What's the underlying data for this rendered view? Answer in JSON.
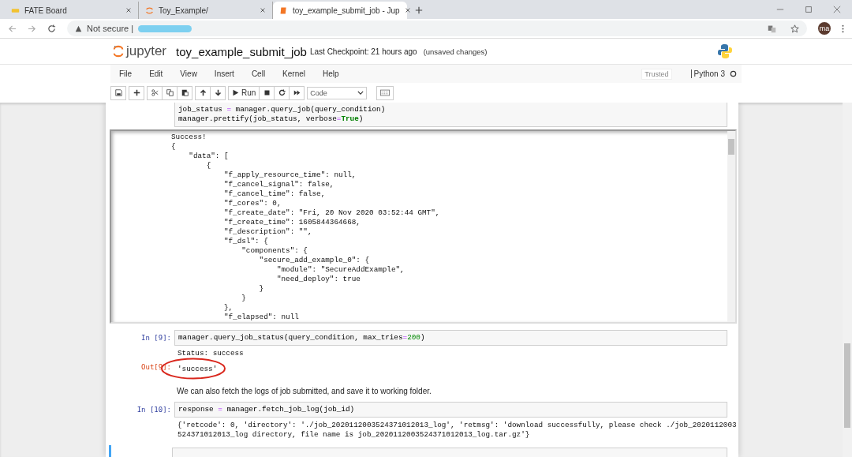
{
  "browser": {
    "tabs": [
      {
        "title": "FATE Board",
        "kind": "fate",
        "selected": false
      },
      {
        "title": "Toy_Example/",
        "kind": "jupyter",
        "selected": false
      },
      {
        "title": "toy_example_submit_job - Jup",
        "kind": "notebook",
        "selected": true
      }
    ],
    "security": "Not secure |",
    "avatar": "ma"
  },
  "header": {
    "logo": "jupyter",
    "title": "toy_example_submit_job",
    "checkpoint": "Last Checkpoint: 21 hours ago",
    "unsaved": "(unsaved changes)"
  },
  "menu": [
    "File",
    "Edit",
    "View",
    "Insert",
    "Cell",
    "Kernel",
    "Help"
  ],
  "trusted": "Trusted",
  "kernel": "Python 3",
  "toolbar": [
    [
      {
        "kind": "save"
      }
    ],
    [
      {
        "kind": "plus"
      }
    ],
    [
      {
        "kind": "cut"
      },
      {
        "kind": "copy"
      },
      {
        "kind": "paste"
      }
    ],
    [
      {
        "kind": "up"
      },
      {
        "kind": "down"
      }
    ],
    [
      {
        "kind": "run",
        "label": "Run"
      },
      {
        "kind": "stop"
      },
      {
        "kind": "restart"
      },
      {
        "kind": "fastforward"
      }
    ]
  ],
  "cell_type": "Code",
  "cells": [
    {
      "kind": "code",
      "selected": false,
      "lines": [
        [
          {
            "t": "job_status "
          },
          {
            "t": "=",
            "kind": "op"
          },
          {
            "t": " manager.query_job(query_condition)"
          }
        ],
        [
          {
            "t": "manager.prettify(job_status, verbose"
          },
          {
            "t": "=",
            "kind": "op"
          },
          {
            "t": "True",
            "kind": "kw"
          },
          {
            "t": ")"
          }
        ]
      ],
      "outputs": [
        {
          "kind": "scroll",
          "lines": [
            "Success!",
            "{",
            "    \"data\": [",
            "        {",
            "            \"f_apply_resource_time\": null,",
            "            \"f_cancel_signal\": false,",
            "            \"f_cancel_time\": false,",
            "            \"f_cores\": 0,",
            "            \"f_create_date\": \"Fri, 20 Nov 2020 03:52:44 GMT\",",
            "            \"f_create_time\": 1605844364668,",
            "            \"f_description\": \"\",",
            "            \"f_dsl\": {",
            "                \"components\": {",
            "                    \"secure_add_example_0\": {",
            "                        \"module\": \"SecureAddExample\",",
            "                        \"need_deploy\": true",
            "                    }",
            "                }",
            "            },",
            "            \"f_elapsed\": null"
          ]
        }
      ]
    },
    {
      "kind": "code",
      "prompt": "In [9]:",
      "selected": false,
      "lines": [
        [
          {
            "t": "manager.query_job_status(query_condition, max_tries"
          },
          {
            "t": "=",
            "kind": "op"
          },
          {
            "t": "200",
            "kind": "num"
          },
          {
            "t": ")"
          }
        ]
      ],
      "outputs": [
        {
          "kind": "stream",
          "lines": [
            "Status: success"
          ]
        },
        {
          "kind": "result",
          "prompt": "Out[9]:",
          "text": "'success'",
          "circled": true
        }
      ]
    },
    {
      "kind": "markdown",
      "text": "We can also fetch the logs of job submitted, and save it to working folder."
    },
    {
      "kind": "code",
      "prompt": "In [10]:",
      "selected": false,
      "lines": [
        [
          {
            "t": "response "
          },
          {
            "t": "=",
            "kind": "op"
          },
          {
            "t": " manager.fetch_job_log(job_id)"
          }
        ]
      ],
      "outputs": [
        {
          "kind": "stream",
          "lines": [
            "{'retcode': 0, 'directory': './job_2020112003524371012013_log', 'retmsg': 'download successfully, please check ./job_2020112003",
            "524371012013_log directory, file name is job_2020112003524371012013_log.tar.gz'}"
          ]
        }
      ]
    },
    {
      "kind": "code",
      "selected": true
    }
  ]
}
